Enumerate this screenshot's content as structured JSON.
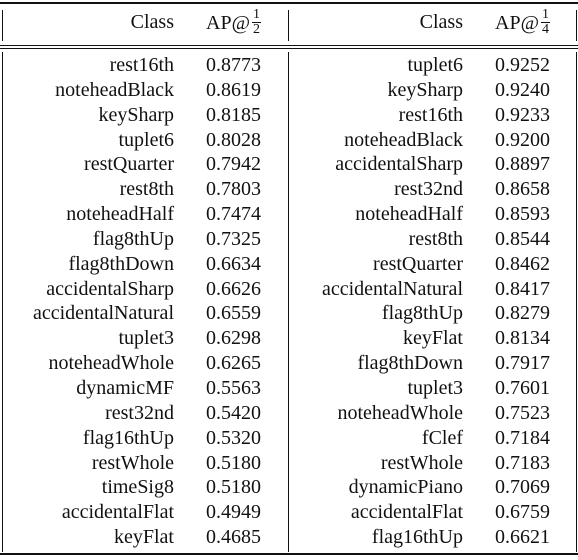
{
  "table": {
    "left": {
      "header": {
        "class_label": "Class",
        "ap_label": "AP@",
        "ap_num": "1",
        "ap_den": "2"
      },
      "rows": [
        {
          "class": "rest16th",
          "ap": "0.8773"
        },
        {
          "class": "noteheadBlack",
          "ap": "0.8619"
        },
        {
          "class": "keySharp",
          "ap": "0.8185"
        },
        {
          "class": "tuplet6",
          "ap": "0.8028"
        },
        {
          "class": "restQuarter",
          "ap": "0.7942"
        },
        {
          "class": "rest8th",
          "ap": "0.7803"
        },
        {
          "class": "noteheadHalf",
          "ap": "0.7474"
        },
        {
          "class": "flag8thUp",
          "ap": "0.7325"
        },
        {
          "class": "flag8thDown",
          "ap": "0.6634"
        },
        {
          "class": "accidentalSharp",
          "ap": "0.6626"
        },
        {
          "class": "accidentalNatural",
          "ap": "0.6559"
        },
        {
          "class": "tuplet3",
          "ap": "0.6298"
        },
        {
          "class": "noteheadWhole",
          "ap": "0.6265"
        },
        {
          "class": "dynamicMF",
          "ap": "0.5563"
        },
        {
          "class": "rest32nd",
          "ap": "0.5420"
        },
        {
          "class": "flag16thUp",
          "ap": "0.5320"
        },
        {
          "class": "restWhole",
          "ap": "0.5180"
        },
        {
          "class": "timeSig8",
          "ap": "0.5180"
        },
        {
          "class": "accidentalFlat",
          "ap": "0.4949"
        },
        {
          "class": "keyFlat",
          "ap": "0.4685"
        }
      ]
    },
    "right": {
      "header": {
        "class_label": "Class",
        "ap_label": "AP@",
        "ap_num": "1",
        "ap_den": "4"
      },
      "rows": [
        {
          "class": "tuplet6",
          "ap": "0.9252"
        },
        {
          "class": "keySharp",
          "ap": "0.9240"
        },
        {
          "class": "rest16th",
          "ap": "0.9233"
        },
        {
          "class": "noteheadBlack",
          "ap": "0.9200"
        },
        {
          "class": "accidentalSharp",
          "ap": "0.8897"
        },
        {
          "class": "rest32nd",
          "ap": "0.8658"
        },
        {
          "class": "noteheadHalf",
          "ap": "0.8593"
        },
        {
          "class": "rest8th",
          "ap": "0.8544"
        },
        {
          "class": "restQuarter",
          "ap": "0.8462"
        },
        {
          "class": "accidentalNatural",
          "ap": "0.8417"
        },
        {
          "class": "flag8thUp",
          "ap": "0.8279"
        },
        {
          "class": "keyFlat",
          "ap": "0.8134"
        },
        {
          "class": "flag8thDown",
          "ap": "0.7917"
        },
        {
          "class": "tuplet3",
          "ap": "0.7601"
        },
        {
          "class": "noteheadWhole",
          "ap": "0.7523"
        },
        {
          "class": "fClef",
          "ap": "0.7184"
        },
        {
          "class": "restWhole",
          "ap": "0.7183"
        },
        {
          "class": "dynamicPiano",
          "ap": "0.7069"
        },
        {
          "class": "accidentalFlat",
          "ap": "0.6759"
        },
        {
          "class": "flag16thUp",
          "ap": "0.6621"
        }
      ]
    }
  }
}
